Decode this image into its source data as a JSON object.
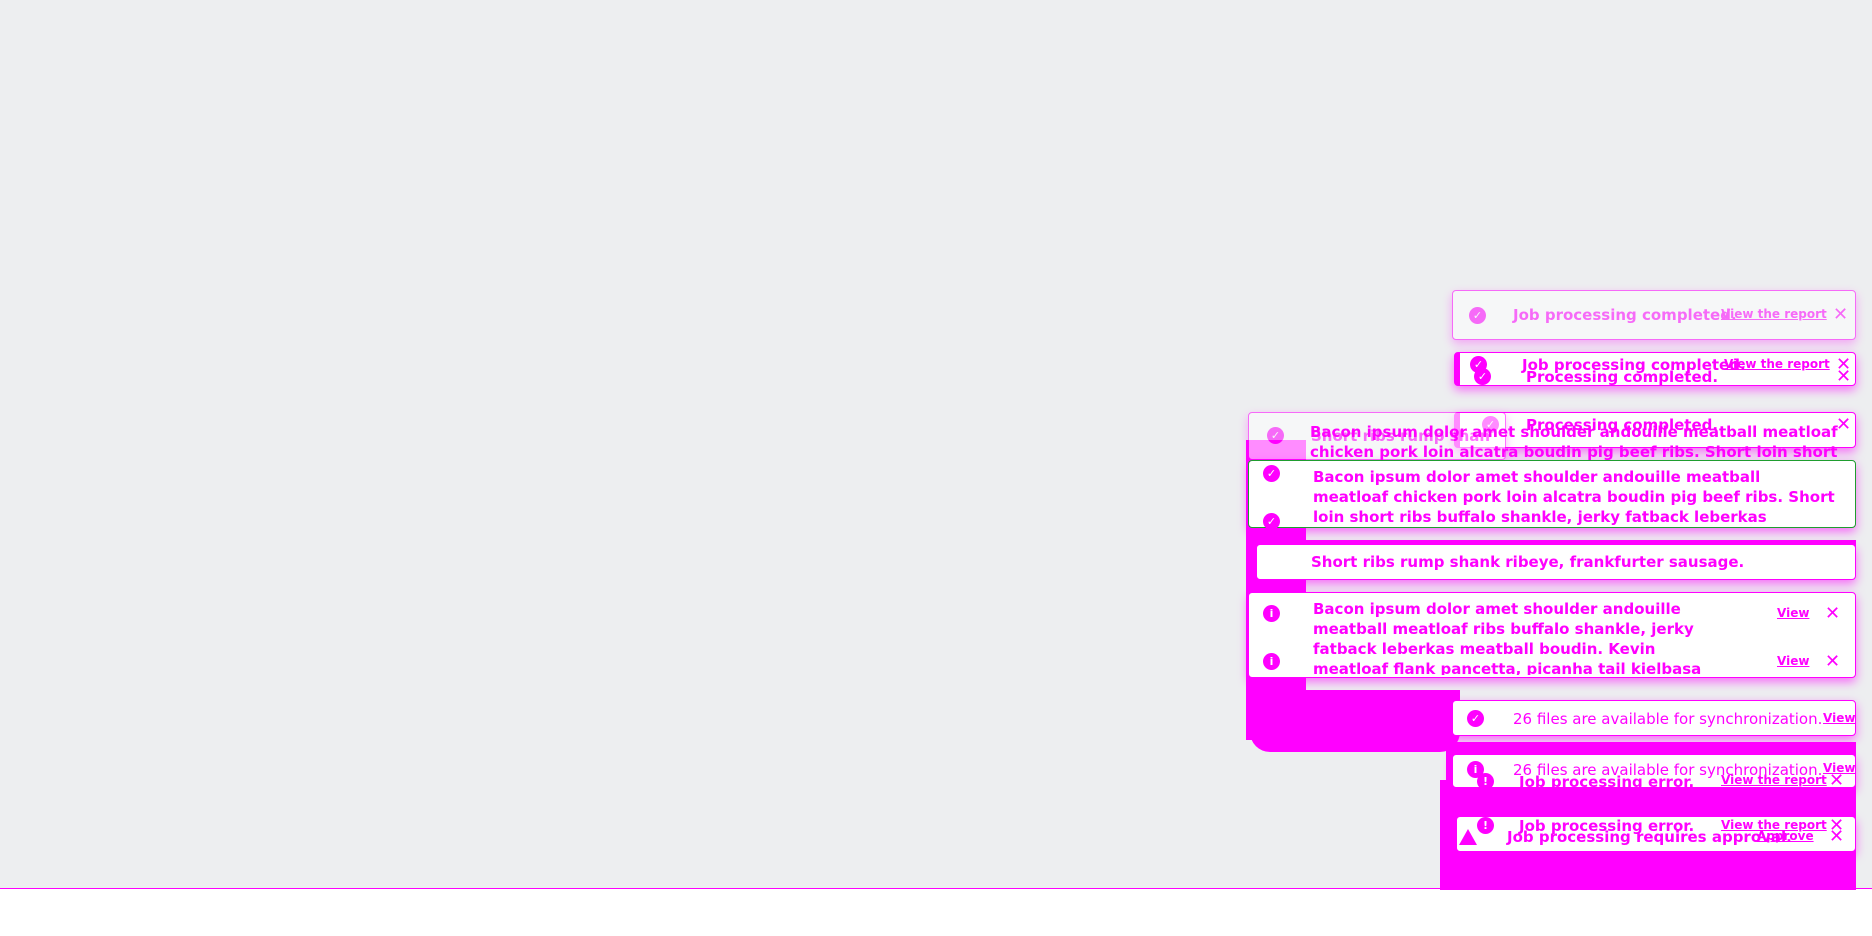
{
  "colors": {
    "canvas_background": "#edeef0",
    "notification_accent": "#ff00ff",
    "success_edge": "#1f9d2f"
  },
  "icons": {
    "success": "check-circle-icon",
    "info": "info-circle-icon",
    "error": "exclamation-circle-icon",
    "warning": "warning-triangle-icon",
    "close": "close-icon"
  },
  "notifications": {
    "job_completed": "Job processing completed.",
    "processing_completed": "Processing completed.",
    "job_error": "Job processing error.",
    "job_approval": "Job processing requires approval.",
    "files_available": "26 files are available for synchronization.",
    "short_ribs": "Short ribs rump shank ribeye, frankfurter sausage.",
    "lorem_long": "Bacon ipsum dolor amet shoulder andouille meatball meatloaf chicken pork loin alcatra boudin pig beef ribs. Short loin short ribs buffalo shankle, jerky fatback leberkas meatball boudin. Kevin meatloaf flank pancetta, picanha tail kielbasa salami ham hock sirloin cow frankfurter capicola. Jowl shankle short ribs rump shank ribeye, frankfurter sausage.",
    "lorem_medium": "Bacon ipsum dolor amet shoulder andouille meatball meatloaf ribs buffalo shankle, jerky fatback leberkas meatball boudin. Kevin meatloaf flank pancetta, picanha tail kielbasa salami ham hock sirloin cow frankfurter capicola. Jowl shankle short ribs rump shank ribeye, frankfurter sausage."
  },
  "actions": {
    "view_report": "View the report",
    "view": "View",
    "approve": "Approve",
    "close_glyph": "✕"
  }
}
